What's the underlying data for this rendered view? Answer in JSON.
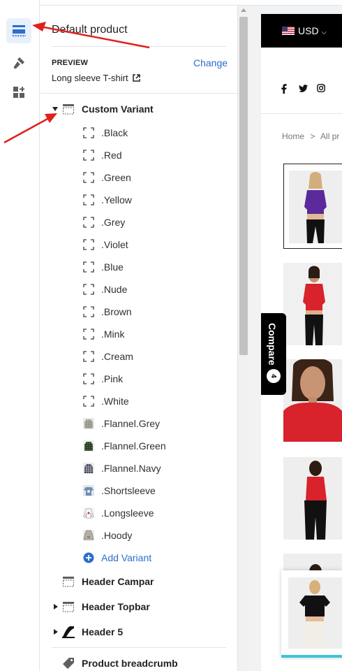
{
  "rail": {
    "items": [
      {
        "name": "sections-icon",
        "active": true
      },
      {
        "name": "theme-settings-icon",
        "active": false
      },
      {
        "name": "apps-icon",
        "active": false
      }
    ]
  },
  "panel": {
    "title": "Default product",
    "preview_label": "PREVIEW",
    "preview_change": "Change",
    "preview_value": "Long sleeve T-shirt"
  },
  "tree": {
    "custom_variant": "Custom Variant",
    "variants": [
      {
        "label": ".Black",
        "icon": "dashed-block-icon"
      },
      {
        "label": ".Red",
        "icon": "dashed-block-icon"
      },
      {
        "label": ".Green",
        "icon": "dashed-block-icon"
      },
      {
        "label": ".Yellow",
        "icon": "dashed-block-icon"
      },
      {
        "label": ".Grey",
        "icon": "dashed-block-icon"
      },
      {
        "label": ".Violet",
        "icon": "dashed-block-icon"
      },
      {
        "label": ".Blue",
        "icon": "dashed-block-icon"
      },
      {
        "label": ".Nude",
        "icon": "dashed-block-icon"
      },
      {
        "label": ".Brown",
        "icon": "dashed-block-icon"
      },
      {
        "label": ".Mink",
        "icon": "dashed-block-icon"
      },
      {
        "label": ".Cream",
        "icon": "dashed-block-icon"
      },
      {
        "label": ".Pink",
        "icon": "dashed-block-icon"
      },
      {
        "label": ".White",
        "icon": "dashed-block-icon"
      },
      {
        "label": ".Flannel.Grey",
        "icon": "flannel-grey-thumbnail"
      },
      {
        "label": ".Flannel.Green",
        "icon": "flannel-green-thumbnail"
      },
      {
        "label": ".Flannel.Navy",
        "icon": "flannel-navy-thumbnail"
      },
      {
        "label": ".Shortsleeve",
        "icon": "shortsleeve-thumbnail"
      },
      {
        "label": ".Longsleeve",
        "icon": "longsleeve-thumbnail"
      },
      {
        "label": ".Hoody",
        "icon": "hoody-thumbnail"
      }
    ],
    "add_variant": "Add Variant",
    "sections": [
      {
        "label": "Header Campar",
        "icon": "section-header-icon",
        "expandable": false
      },
      {
        "label": "Header Topbar",
        "icon": "section-header-icon",
        "expandable": true
      },
      {
        "label": "Header 5",
        "icon": "header-5-icon",
        "expandable": true
      },
      {
        "label": "Product breadcrumb",
        "icon": "tag-icon",
        "expandable": false
      }
    ]
  },
  "store": {
    "currency": "USD",
    "social": [
      "f",
      "t",
      "ig"
    ],
    "breadcrumb_home": "Home",
    "breadcrumb_sep": ">",
    "breadcrumb_next": "All pr",
    "compare_label": "Compare",
    "compare_count": "4"
  },
  "colors": {
    "accent": "#2c6ecb",
    "annotation": "#e0201c",
    "product_red": "#d8222c",
    "product_purple": "#5b2a9a"
  }
}
